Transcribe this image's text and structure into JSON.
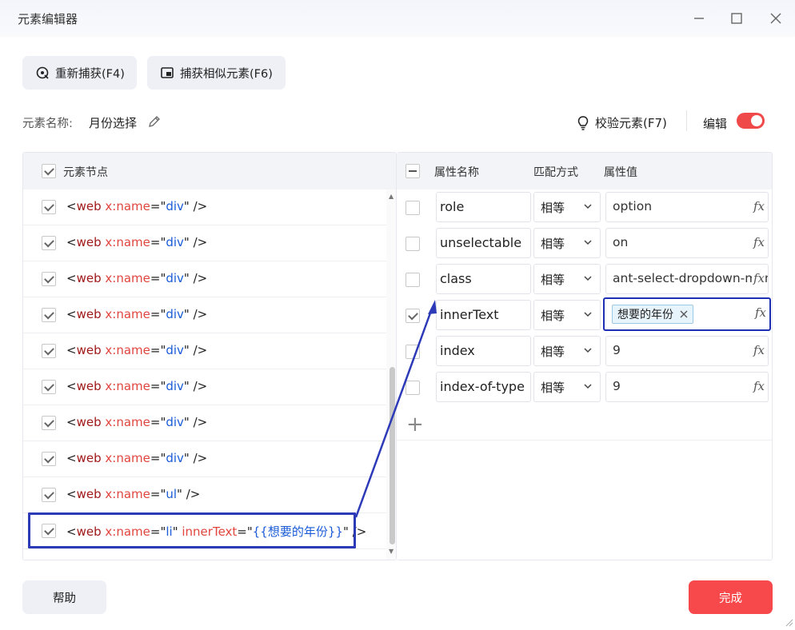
{
  "window": {
    "title": "元素编辑器"
  },
  "toolbar": {
    "recapture_label": "重新捕获(F4)",
    "capture_similar_label": "捕获相似元素(F6)"
  },
  "element": {
    "name_label": "元素名称:",
    "name_value": "月份选择",
    "verify_label": "校验元素(F7)",
    "edit_label": "编辑",
    "edit_enabled": true
  },
  "nodes_panel": {
    "header": "元素节点",
    "rows": [
      {
        "checked": true,
        "tag": "web",
        "attr": "x:name",
        "value": "div"
      },
      {
        "checked": true,
        "tag": "web",
        "attr": "x:name",
        "value": "div"
      },
      {
        "checked": true,
        "tag": "web",
        "attr": "x:name",
        "value": "div"
      },
      {
        "checked": true,
        "tag": "web",
        "attr": "x:name",
        "value": "div"
      },
      {
        "checked": true,
        "tag": "web",
        "attr": "x:name",
        "value": "div"
      },
      {
        "checked": true,
        "tag": "web",
        "attr": "x:name",
        "value": "div"
      },
      {
        "checked": true,
        "tag": "web",
        "attr": "x:name",
        "value": "div"
      },
      {
        "checked": true,
        "tag": "web",
        "attr": "x:name",
        "value": "div"
      },
      {
        "checked": true,
        "tag": "web",
        "attr": "x:name",
        "value": "ul"
      },
      {
        "checked": true,
        "tag": "web",
        "attr": "x:name",
        "value": "li",
        "extra_attr": "innerText",
        "extra_value": "{{想要的年份}}"
      }
    ]
  },
  "attrs_panel": {
    "col_name": "属性名称",
    "col_match": "匹配方式",
    "col_value": "属性值",
    "rows": [
      {
        "checked": false,
        "name": "role",
        "match": "相等",
        "value": "option"
      },
      {
        "checked": false,
        "name": "unselectable",
        "match": "相等",
        "value": "on"
      },
      {
        "checked": false,
        "name": "class",
        "match": "相等",
        "value": "ant-select-dropdown-menu-item"
      },
      {
        "checked": true,
        "name": "innerText",
        "match": "相等",
        "value_tag": "想要的年份"
      },
      {
        "checked": false,
        "name": "index",
        "match": "相等",
        "value": "9"
      },
      {
        "checked": false,
        "name": "index-of-type",
        "match": "相等",
        "value": "9"
      }
    ],
    "add_label": "+"
  },
  "footer": {
    "help_label": "帮助",
    "done_label": "完成"
  },
  "colors": {
    "accent": "#f7484b",
    "highlight": "#2d3ab8",
    "tag_name": "#a01919",
    "attr_name": "#e0453e",
    "attr_value": "#1a5bd8"
  }
}
